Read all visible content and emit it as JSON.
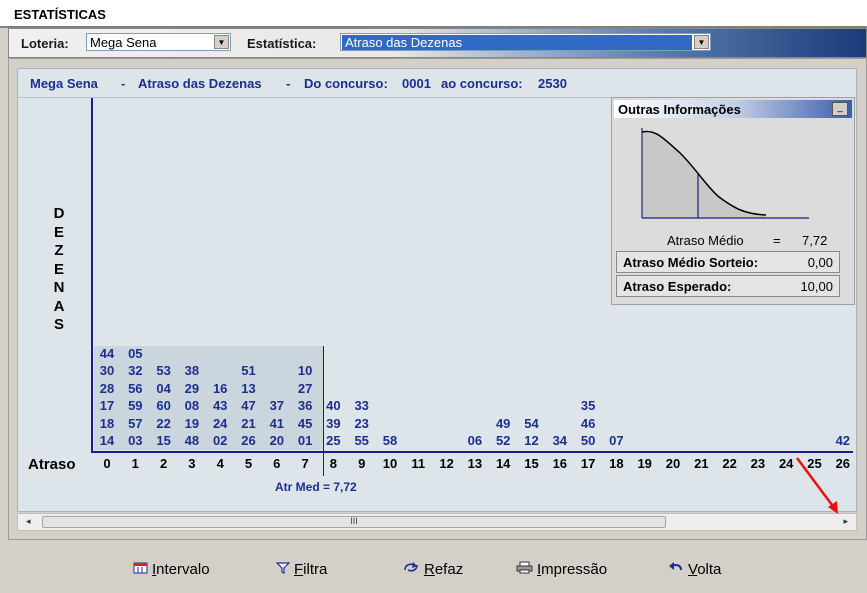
{
  "window": {
    "title": "ESTATÍSTICAS"
  },
  "toolbar": {
    "loteria_label": "Loteria:",
    "loteria_value": "Mega Sena",
    "estatistica_label": "Estatística:",
    "estatistica_value": "Atraso das Dezenas"
  },
  "chart_header": {
    "lottery": "Mega Sena",
    "sep1": "-",
    "stat": "Atraso das Dezenas",
    "sep2": "-",
    "range_from_label": "Do concurso:",
    "range_from": "0001",
    "range_to_label": "ao concurso:",
    "range_to": "2530"
  },
  "chart_data": {
    "type": "table",
    "ylabel": "DEZENAS",
    "xlabel": "Atraso",
    "x": [
      "0",
      "1",
      "2",
      "3",
      "4",
      "5",
      "6",
      "7",
      "8",
      "9",
      "10",
      "11",
      "12",
      "13",
      "14",
      "15",
      "16",
      "17",
      "18",
      "19",
      "20",
      "21",
      "22",
      "23",
      "24",
      "25",
      "26"
    ],
    "columns": {
      "0": [
        "14",
        "18",
        "17",
        "28",
        "30",
        "44"
      ],
      "1": [
        "03",
        "57",
        "59",
        "56",
        "32",
        "05"
      ],
      "2": [
        "15",
        "22",
        "60",
        "04",
        "53"
      ],
      "3": [
        "48",
        "19",
        "08",
        "29",
        "38"
      ],
      "4": [
        "02",
        "24",
        "43",
        "16"
      ],
      "5": [
        "26",
        "21",
        "47",
        "13",
        "51"
      ],
      "6": [
        "20",
        "41",
        "37"
      ],
      "7": [
        "01",
        "45",
        "36",
        "27",
        "10"
      ],
      "8": [
        "25",
        "39",
        "40"
      ],
      "9": [
        "55",
        "23",
        "33"
      ],
      "10": [
        "58"
      ],
      "13": [
        "06"
      ],
      "14": [
        "52",
        "49"
      ],
      "15": [
        "12",
        "54"
      ],
      "16": [
        "34"
      ],
      "17": [
        "50",
        "46",
        "35"
      ],
      "18": [
        "07"
      ],
      "26": [
        "42"
      ]
    },
    "shaded_up_to": 7.72,
    "mean_label": "Atr Med = 7,72"
  },
  "outras": {
    "title": "Outras Informações",
    "minimize": "_",
    "atraso_medio_label": "Atraso Médio",
    "eq": "=",
    "atraso_medio_value": "7,72",
    "sorteio_label": "Atraso Médio Sorteio:",
    "sorteio_value": "0,00",
    "esperado_label": "Atraso Esperado:",
    "esperado_value": "10,00"
  },
  "scrollbar": {
    "left_arrow": "◂",
    "right_arrow": "▸",
    "grip": "III"
  },
  "buttons": {
    "intervalo": {
      "first": "I",
      "rest": "ntervalo",
      "icon": "calendar-icon"
    },
    "filtra": {
      "first": "F",
      "rest": "iltra",
      "icon": "funnel-icon"
    },
    "refaz": {
      "first": "R",
      "rest": "efaz",
      "icon": "redo-icon"
    },
    "impressao": {
      "first": "I",
      "rest": "mpressão",
      "icon": "printer-icon"
    },
    "volta": {
      "first": "V",
      "rest": "olta",
      "icon": "back-arrow-icon"
    }
  },
  "colors": {
    "accent": "#1c2f8f",
    "highlight": "#316ac5",
    "annotation": "#e8140c"
  }
}
